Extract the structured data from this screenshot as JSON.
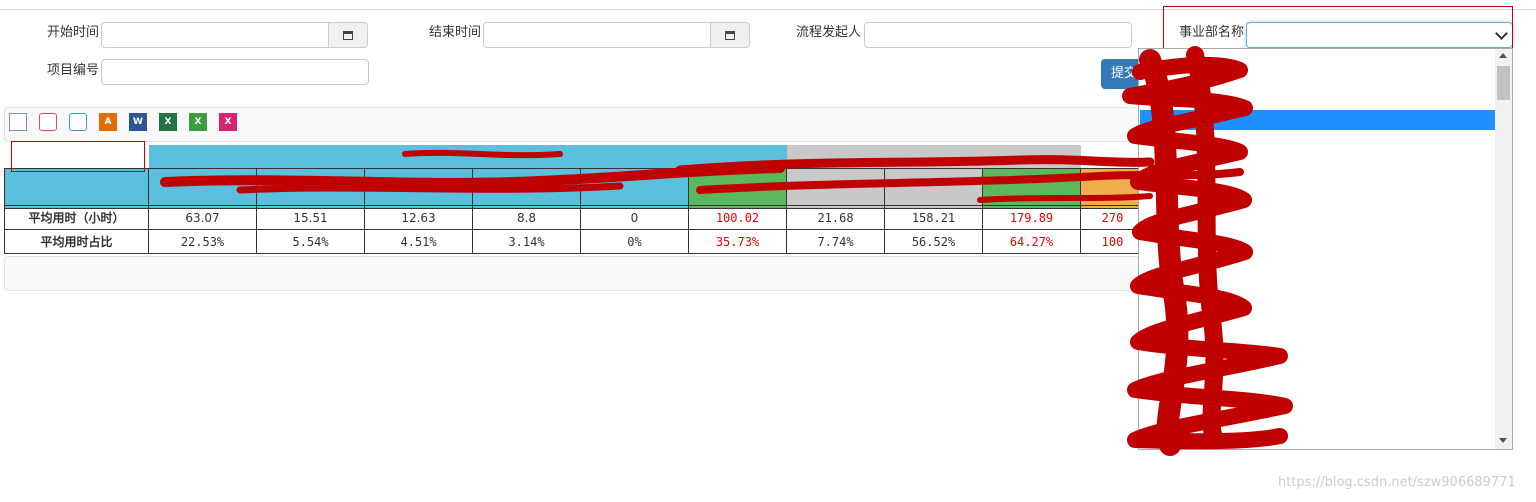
{
  "filters": {
    "start_time_label": "开始时间",
    "end_time_label": "结束时间",
    "initiator_label": "流程发起人",
    "division_label": "事业部名称",
    "project_no_label": "项目编号"
  },
  "submit_label": "提交",
  "toolbar": {
    "icons": [
      "text-export-icon",
      "print-icon",
      "print-preview-icon",
      "pdf-icon",
      "word-icon",
      "excel-icon",
      "excel-icon-2",
      "excel-icon-3"
    ]
  },
  "table": {
    "rows": [
      {
        "label": "平均用时（小时）",
        "cells": [
          "63.07",
          "15.51",
          "12.63",
          "8.8",
          "0",
          "100.02",
          "21.68",
          "158.21",
          "179.89",
          "270"
        ]
      },
      {
        "label": "平均用时占比",
        "cells": [
          "22.53%",
          "5.54%",
          "4.51%",
          "3.14%",
          "0%",
          "35.73%",
          "7.74%",
          "56.52%",
          "64.27%",
          "100"
        ]
      }
    ],
    "red_columns": [
      5,
      8,
      9
    ]
  },
  "colors": {
    "header_blue": "#5bc0de",
    "header_gray": "#c8c8c8",
    "header_green": "#5cb85c",
    "header_orange": "#f0ad4e",
    "highlight": "#1e90ff",
    "scribble": "#c00000"
  },
  "watermark": "https://blog.csdn.net/szw906689771"
}
